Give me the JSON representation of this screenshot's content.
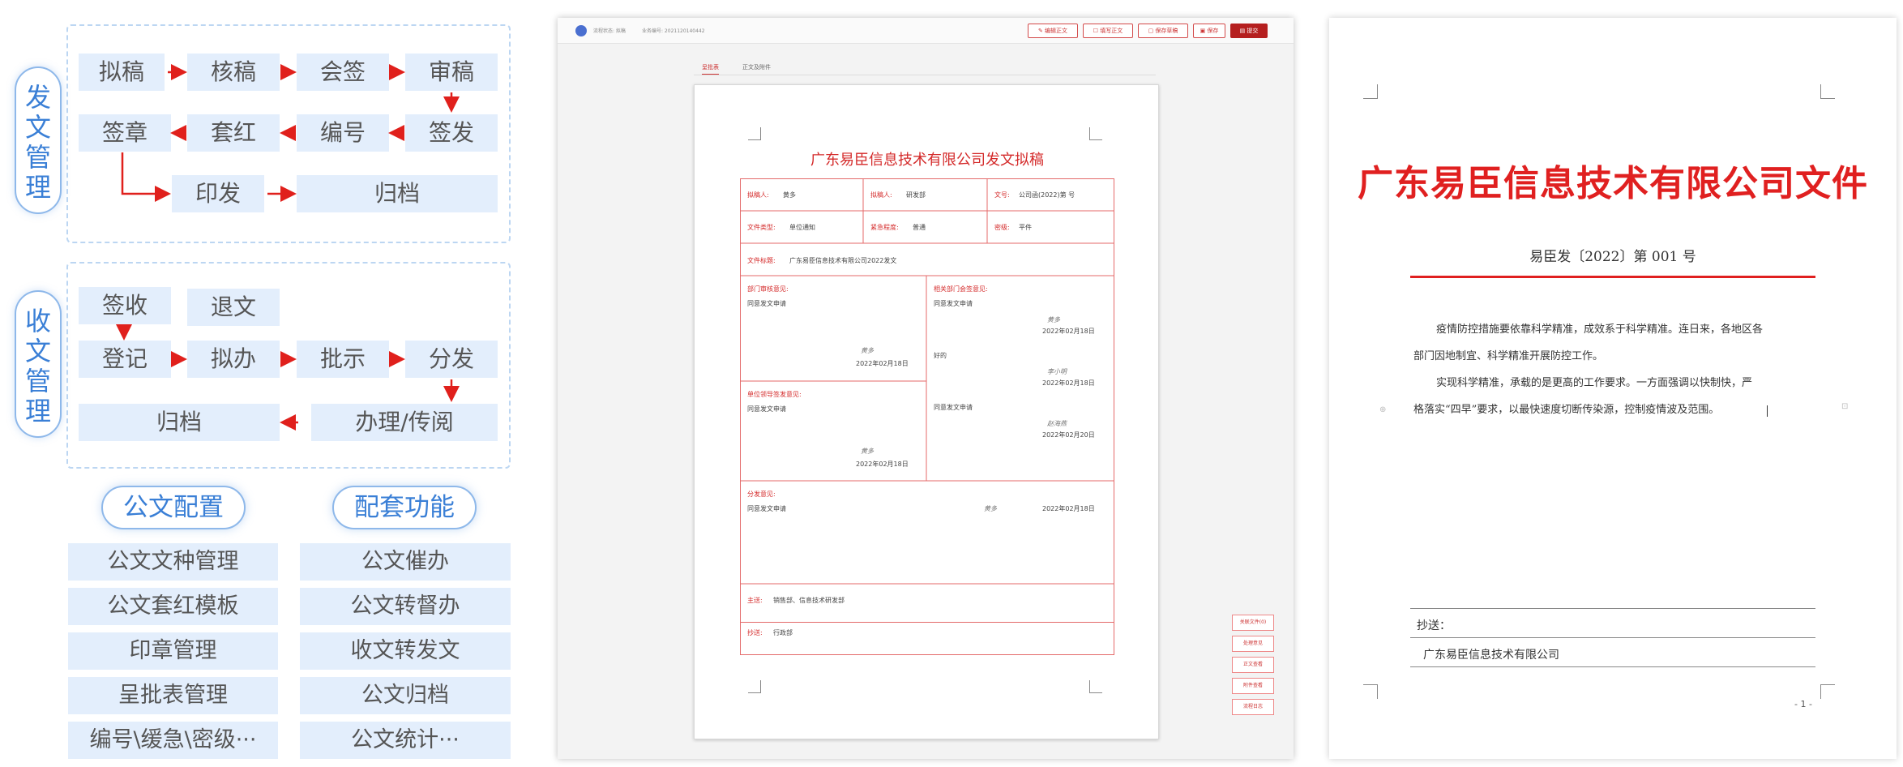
{
  "diagram": {
    "dispatch_label": "发文管理",
    "dispatch_nodes": [
      "拟稿",
      "核稿",
      "会签",
      "审稿",
      "签章",
      "套红",
      "编号",
      "签发",
      "印发",
      "归档"
    ],
    "receive_label": "收文管理",
    "receive_nodes": [
      "签收",
      "退文",
      "登记",
      "拟办",
      "批示",
      "分发",
      "归档",
      "办理/传阅"
    ],
    "config_title": "公文配置",
    "support_title": "配套功能",
    "config_items": [
      "公文文种管理",
      "公文套红模板",
      "印章管理",
      "呈批表管理",
      "编号\\缓急\\密级···"
    ],
    "support_items": [
      "公文催办",
      "公文转督办",
      "收文转发文",
      "公文归档",
      "公文统计···"
    ]
  },
  "app": {
    "header_status": "流程状态: 拟稿",
    "header_no": "业务编号: 2021120140442",
    "toolbar": [
      "编辑正文",
      "填写正文",
      "保存草稿",
      "保存",
      "提交"
    ],
    "tabs": [
      "呈批表",
      "正文及附件"
    ],
    "side_buttons": [
      "关联文件(0)",
      "处理意见",
      "正文查看",
      "附件查看",
      "流程日志"
    ],
    "form": {
      "title": "广东易臣信息技术有限公司发文拟稿",
      "drafter_label": "拟稿人:",
      "drafter": "黄多",
      "dept_label": "拟稿人:",
      "dept": "研发部",
      "docno_label": "文号:",
      "docno": "公司函(2022)第 号",
      "type_label": "文件类型:",
      "type": "单位通知",
      "urgency_label": "紧急程度:",
      "urgency": "普通",
      "secret_label": "密级:",
      "secret": "平件",
      "subject_label": "文件标题:",
      "subject": "广东易臣信息技术有限公司2022发文",
      "dept_opinion_label": "部门审核意见:",
      "dept_opinion": "同意发文申请",
      "dept_sig": "黄多",
      "dept_date": "2022年02月18日",
      "cosign_label": "相关部门会签意见:",
      "cosign_1": "同意发文申请",
      "cosign_1_sig": "黄多",
      "cosign_1_date": "2022年02月18日",
      "cosign_2": "好的",
      "cosign_2_sig": "李小明",
      "cosign_2_date": "2022年02月18日",
      "cosign_3": "同意发文申请",
      "cosign_3_sig": "赵海燕",
      "cosign_3_date": "2022年02月20日",
      "leader_label": "单位领导签发意见:",
      "leader_opinion": "同意发文申请",
      "leader_sig": "黄多",
      "leader_date": "2022年02月18日",
      "dist_label": "分发意见:",
      "dist_opinion": "同意发文申请",
      "dist_sig": "黄多",
      "dist_date": "2022年02月18日",
      "main_send_label": "主送:",
      "main_send": "销售部、信息技术研发部",
      "copy_label": "抄送:",
      "copy": "行政部"
    }
  },
  "doc": {
    "title": "广东易臣信息技术有限公司文件",
    "number": "易臣发〔2022〕第 001 号",
    "para1_a": "疫情防控措施要依靠科学精准，成效系于科学精准。连日来，各地区各",
    "para1_b": "部门因地制宜、科学精准开展防控工作。",
    "para2_a": "实现科学精准，承载的是更高的工作要求。一方面强调以快制快，严",
    "para2_b": "格落实“四早”要求，以最快速度切断传染源，控制疫情波及范围。",
    "cc_label": "抄送：",
    "company": "广东易臣信息技术有限公司",
    "page": "- 1 -"
  },
  "colors": {
    "accent_blue": "#3a7fd6",
    "node_bg": "#e3eefc",
    "arrow_red": "#e0201c",
    "doc_red": "#e02020"
  }
}
